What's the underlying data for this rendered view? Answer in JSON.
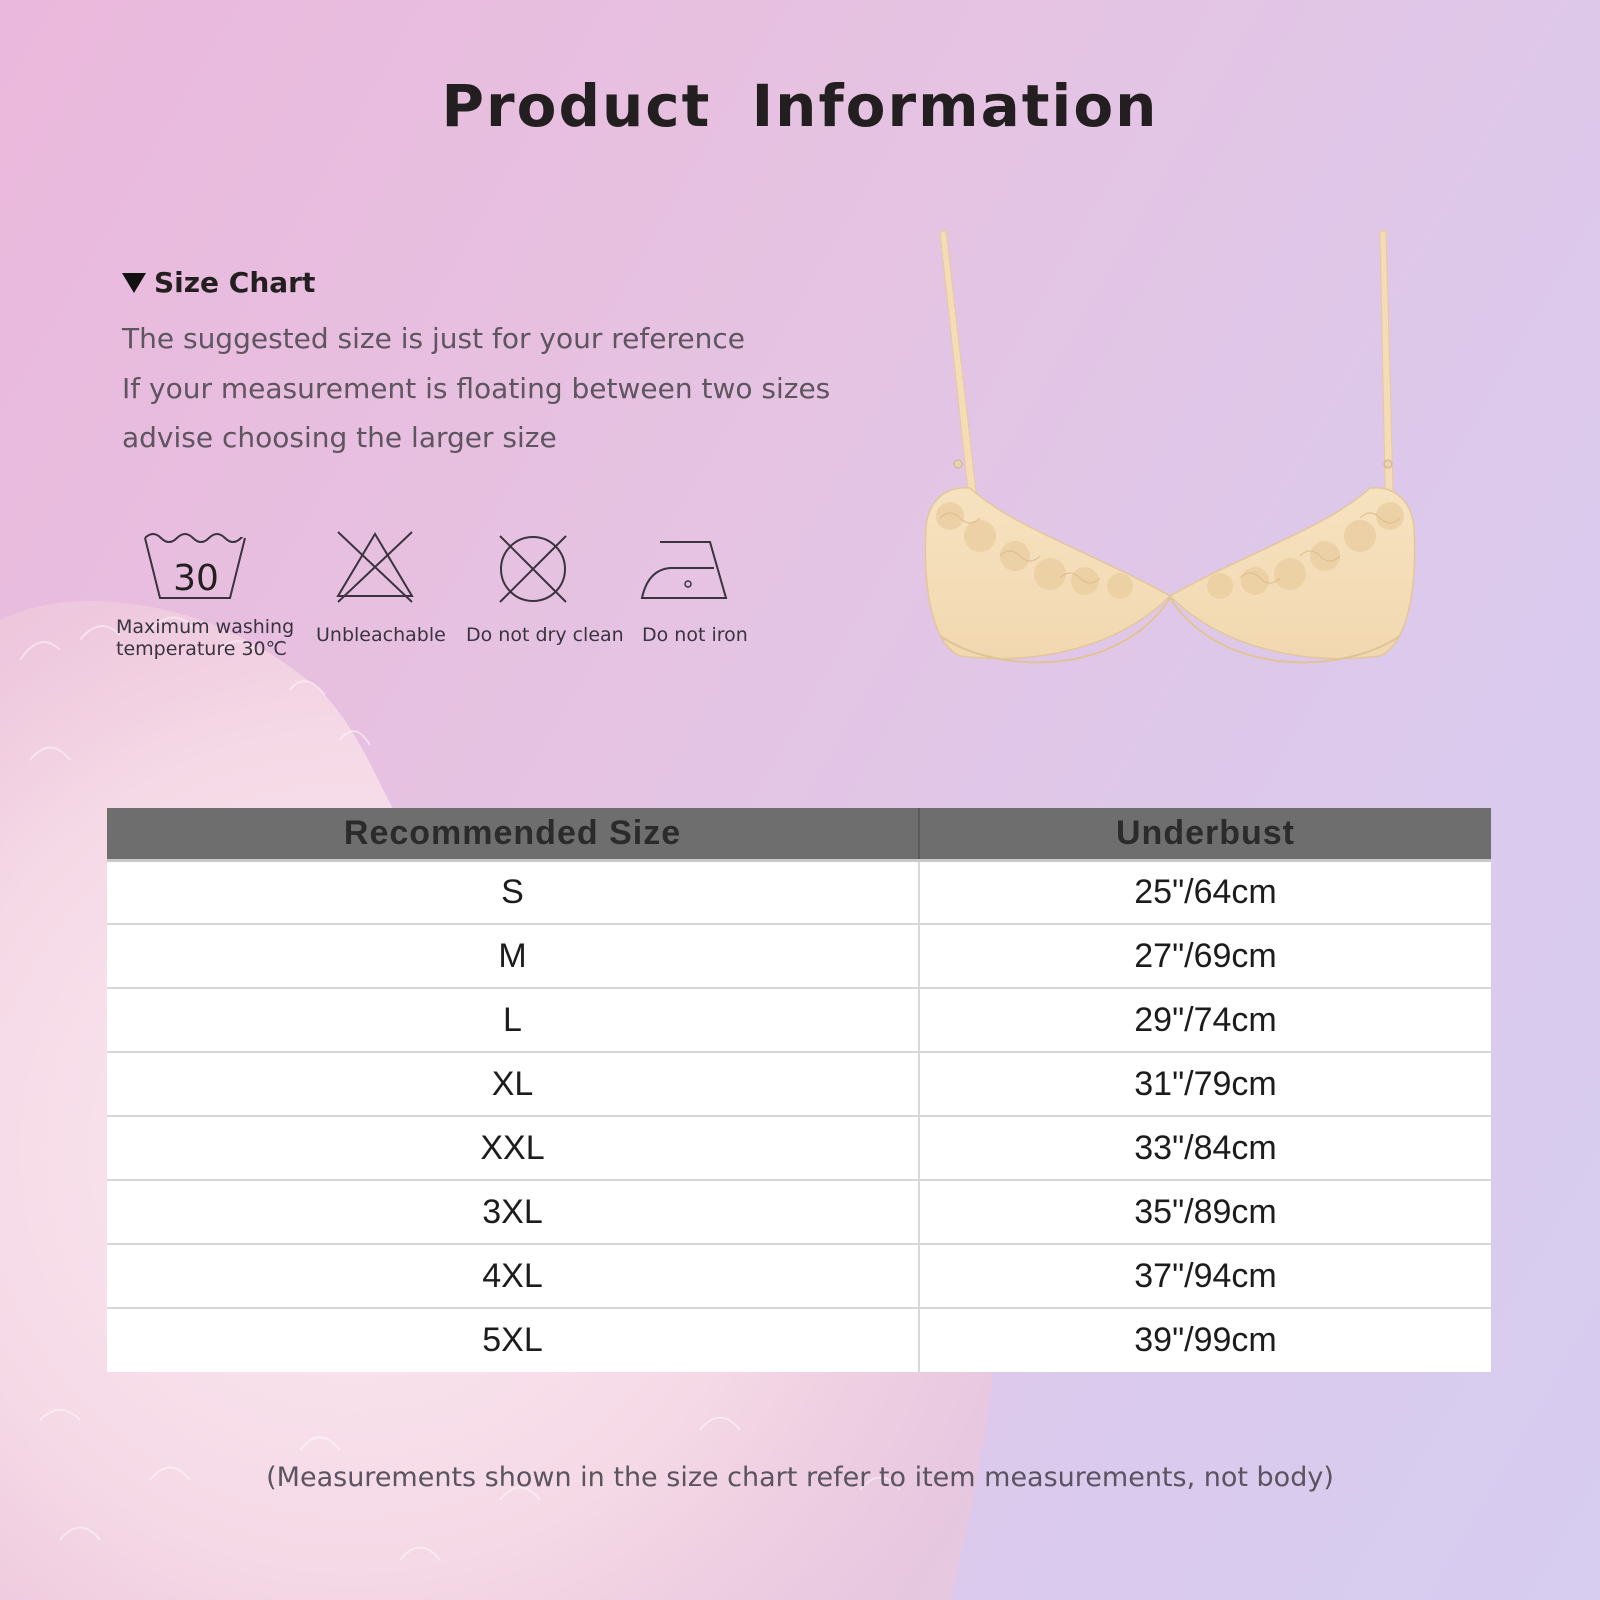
{
  "header": {
    "title": "Product  Information"
  },
  "size_chart": {
    "heading": "Size Chart",
    "notes": [
      "The suggested size is just for your reference",
      "If your measurement is floating between two sizes",
      "advise choosing the larger size"
    ]
  },
  "care": {
    "wash_number": "30",
    "items": [
      {
        "icon": "wash-30-icon",
        "label_lines": [
          "Maximum washing",
          "temperature 30℃"
        ]
      },
      {
        "icon": "no-bleach-icon",
        "label_lines": [
          "Unbleachable"
        ]
      },
      {
        "icon": "no-dry-clean-icon",
        "label_lines": [
          "Do not dry clean"
        ]
      },
      {
        "icon": "no-iron-icon",
        "label_lines": [
          "Do not iron"
        ]
      }
    ]
  },
  "table": {
    "headers": [
      "Recommended Size",
      "Underbust"
    ],
    "rows": [
      [
        "S",
        "25\"/64cm"
      ],
      [
        "M",
        "27\"/69cm"
      ],
      [
        "L",
        "29\"/74cm"
      ],
      [
        "XL",
        "31\"/79cm"
      ],
      [
        "XXL",
        "33\"/84cm"
      ],
      [
        "3XL",
        "35\"/89cm"
      ],
      [
        "4XL",
        "37\"/94cm"
      ],
      [
        "5XL",
        "39\"/99cm"
      ]
    ]
  },
  "footnote": "(Measurements shown in the size chart refer to item measurements, not body)",
  "colors": {
    "header_fill": "#6e6e6e",
    "product_color": "#f3dcb8",
    "fur_color": "#f4dbe6"
  }
}
